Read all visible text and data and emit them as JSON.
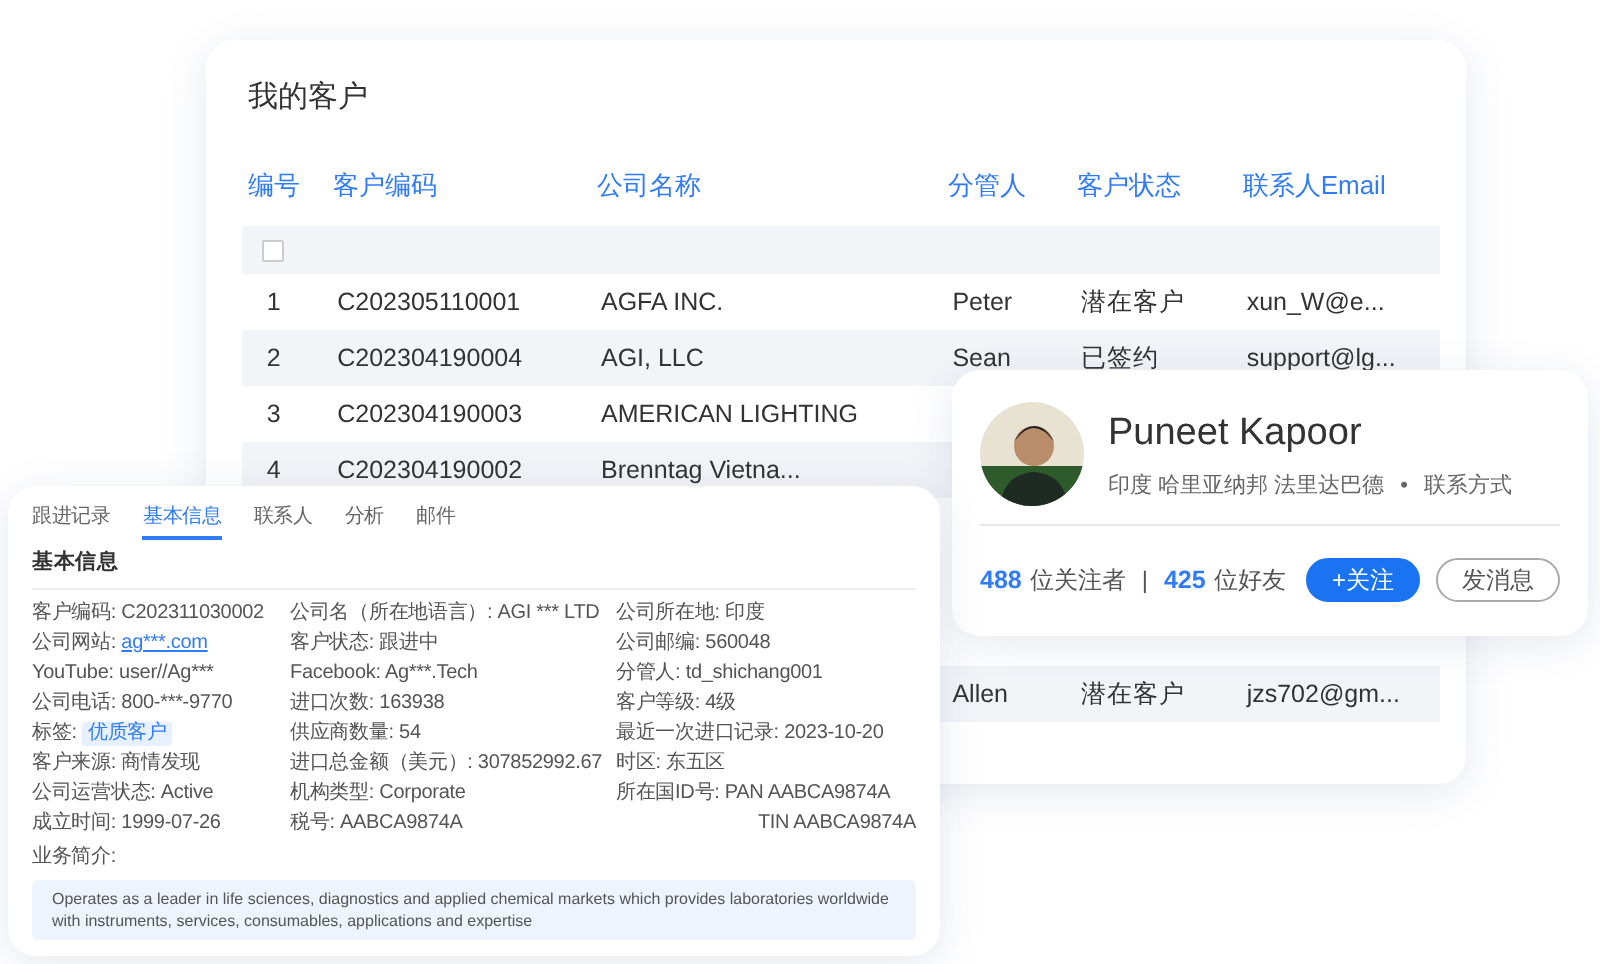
{
  "customers": {
    "title": "我的客户",
    "columns": [
      "编号",
      "客户编码",
      "公司名称",
      "分管人",
      "客户状态",
      "联系人Email"
    ],
    "select_all": {
      "checked": false
    },
    "rows": [
      {
        "number": "1",
        "code": "C202305110001",
        "company": "AGFA INC.",
        "manager": "Peter",
        "status": "潜在客户",
        "email": "xun_W@e..."
      },
      {
        "number": "2",
        "code": "C202304190004",
        "company": "AGI, LLC",
        "manager": "Sean",
        "status": "已签约",
        "email": "support@lg..."
      },
      {
        "number": "3",
        "code": "C202304190003",
        "company": "AMERICAN LIGHTING"
      },
      {
        "number": "4",
        "code": "C202304190002",
        "company": "Brenntag Vietna..."
      },
      {
        "manager": "Allen",
        "status": "潜在客户",
        "email": "jzs702@gm..."
      }
    ]
  },
  "profile": {
    "name": "Puneet Kapoor",
    "location": "印度 哈里亚纳邦 法里达巴德",
    "dot": "•",
    "contact": "联系方式",
    "followers_count": "488",
    "followers_label": "位关注者",
    "stats_separator": "|",
    "friends_count": "425",
    "friends_label": "位好友",
    "buttons": [
      {
        "label": "+关注",
        "kind": "primary"
      },
      {
        "label": "发消息",
        "kind": "outline"
      }
    ]
  },
  "details": {
    "tabs": [
      {
        "label": "跟进记录",
        "selected": false
      },
      {
        "label": "基本信息",
        "selected": true
      },
      {
        "label": "联系人",
        "selected": false
      },
      {
        "label": "分析",
        "selected": false
      },
      {
        "label": "邮件",
        "selected": false
      }
    ],
    "section_title": "基本信息",
    "fields": [
      {
        "kind": "text",
        "label": "客户编码:",
        "value": "C202311030002"
      },
      {
        "kind": "text",
        "label": "公司名（所在地语言）:",
        "value": "AGI *** LTD"
      },
      {
        "kind": "text",
        "label": "公司所在地:",
        "value": "印度"
      },
      {
        "kind": "link",
        "label": "公司网站:",
        "value": "ag***.com"
      },
      {
        "kind": "text",
        "label": "客户状态:",
        "value": "跟进中"
      },
      {
        "kind": "text",
        "label": "公司邮编:",
        "value": "560048"
      },
      {
        "kind": "text",
        "label": "YouTube:",
        "value": "user//Ag***"
      },
      {
        "kind": "text",
        "label": "Facebook:",
        "value": "Ag***.Tech"
      },
      {
        "kind": "text",
        "label": "分管人:",
        "value": "td_shichang001"
      },
      {
        "kind": "text",
        "label": "公司电话:",
        "value": "800-***-9770"
      },
      {
        "kind": "text",
        "label": "进口次数:",
        "value": "163938"
      },
      {
        "kind": "text",
        "label": "客户等级:",
        "value": "4级"
      },
      {
        "kind": "tag",
        "label": "标签:",
        "value": "优质客户"
      },
      {
        "kind": "text",
        "label": "供应商数量:",
        "value": "54"
      },
      {
        "kind": "text",
        "label": "最近一次进口记录:",
        "value": "2023-10-20"
      },
      {
        "kind": "text",
        "label": "客户来源:",
        "value": "商情发现"
      },
      {
        "kind": "text",
        "label": "进口总金额（美元）:",
        "value": "307852992.67"
      },
      {
        "kind": "text",
        "label": "时区:",
        "value": "东五区"
      },
      {
        "kind": "text",
        "label": "公司运营状态:",
        "value": "Active"
      },
      {
        "kind": "text",
        "label": "机构类型:",
        "value": "Corporate"
      },
      {
        "kind": "text",
        "label": "所在国ID号:",
        "value": "PAN AABCA9874A"
      },
      {
        "kind": "text",
        "label": "成立时间:",
        "value": "1999-07-26"
      },
      {
        "kind": "text",
        "label": "税号:",
        "value": "AABCA9874A"
      },
      {
        "kind": "continuation",
        "value": "TIN AABCA9874A"
      }
    ],
    "description_label": "业务简介:",
    "description": "Operates as a leader in life sciences, diagnostics and applied chemical markets which provides laboratories worldwide with instruments, services, consumables, applications and expertise"
  }
}
